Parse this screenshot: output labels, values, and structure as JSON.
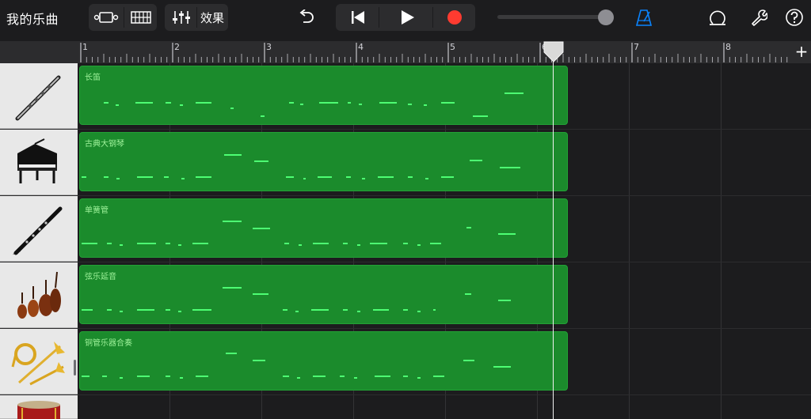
{
  "header": {
    "title": "我的乐曲",
    "fx_label": "效果"
  },
  "toolbar_icons": [
    "view-toggle-icon",
    "tracks-view-icon",
    "mixer-icon",
    "undo-icon",
    "rewind-icon",
    "play-icon",
    "record-icon",
    "metronome-icon",
    "loop-browser-icon",
    "settings-wrench-icon",
    "help-icon"
  ],
  "colors": {
    "record": "#ff3b30",
    "metronome": "#0a84ff",
    "region": "#1b8b2c",
    "note": "#4dff73"
  },
  "ruler": {
    "bars": [
      "1",
      "2",
      "3",
      "4",
      "5",
      "6",
      "7",
      "8"
    ]
  },
  "tracks": [
    {
      "name": "长笛",
      "instrument_icon": "flute-icon"
    },
    {
      "name": "古典大钢琴",
      "instrument_icon": "grand-piano-icon"
    },
    {
      "name": "单簧管",
      "instrument_icon": "clarinet-icon"
    },
    {
      "name": "弦乐延音",
      "instrument_icon": "strings-icon"
    },
    {
      "name": "铜管乐器合奏",
      "instrument_icon": "brass-icon"
    },
    {
      "name": "",
      "instrument_icon": "drum-icon"
    }
  ]
}
